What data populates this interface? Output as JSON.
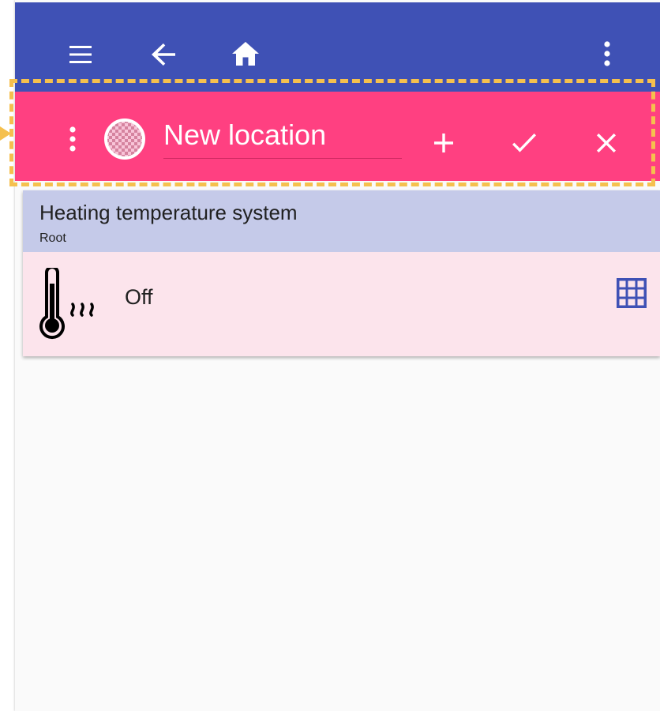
{
  "app_bar": {
    "menu_icon": "menu-icon",
    "back_icon": "arrow-back-icon",
    "home_icon": "home-icon",
    "more_icon": "more-vert-icon",
    "color": "#3f51b5"
  },
  "edit_bar": {
    "more_icon": "more-vert-icon",
    "location_icon": "checkered-circle-icon",
    "location_value": "New location",
    "add_icon": "add-icon",
    "confirm_icon": "check-icon",
    "cancel_icon": "close-icon",
    "color": "#ff4081"
  },
  "highlight_color": "#f5c04e",
  "card": {
    "title": "Heating temperature system",
    "subtitle": "Root",
    "header_color": "#c5cae9",
    "body_color": "#fce4ec",
    "status": "Off",
    "device_icon": "heating-thermometer-icon",
    "action_icon": "grid-icon",
    "action_color": "#3f51b5"
  }
}
